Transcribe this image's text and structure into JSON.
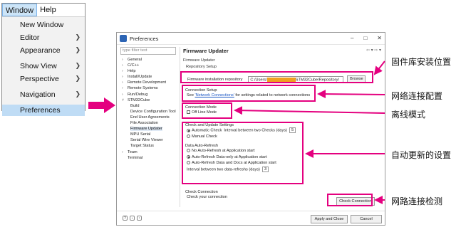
{
  "menu": {
    "bar": [
      "Window",
      "Help"
    ],
    "items": [
      {
        "label": "New Window",
        "submenu": false
      },
      {
        "label": "Editor",
        "submenu": true
      },
      {
        "label": "Appearance",
        "submenu": true
      },
      {
        "label": "Show View",
        "submenu": true
      },
      {
        "label": "Perspective",
        "submenu": true
      },
      {
        "label": "Navigation",
        "submenu": true
      },
      {
        "label": "Preferences",
        "submenu": false
      }
    ],
    "highlighted": "Preferences"
  },
  "dialog": {
    "title": "Preferences",
    "filter_placeholder": "type filter text",
    "tree": [
      {
        "label": "General",
        "level": 0,
        "expanded": false
      },
      {
        "label": "C/C++",
        "level": 0,
        "expanded": false
      },
      {
        "label": "Help",
        "level": 0,
        "expanded": false
      },
      {
        "label": "Install/Update",
        "level": 0,
        "expanded": false
      },
      {
        "label": "Remote Development",
        "level": 0,
        "expanded": false
      },
      {
        "label": "Remote Systems",
        "level": 0,
        "expanded": false
      },
      {
        "label": "Run/Debug",
        "level": 0,
        "expanded": false
      },
      {
        "label": "STM32Cube",
        "level": 0,
        "expanded": true
      },
      {
        "label": "Build",
        "level": 1
      },
      {
        "label": "Device Configuration Tool",
        "level": 1
      },
      {
        "label": "End User Agreements",
        "level": 1
      },
      {
        "label": "File Association",
        "level": 1
      },
      {
        "label": "Firmware Updater",
        "level": 1,
        "selected": true
      },
      {
        "label": "MPU Serial",
        "level": 1
      },
      {
        "label": "Serial Wire Viewer",
        "level": 1
      },
      {
        "label": "Target Status",
        "level": 1
      },
      {
        "label": "Team",
        "level": 0,
        "expanded": false
      },
      {
        "label": "Terminal",
        "level": 0
      }
    ],
    "page_title": "Firmware Updater",
    "subtitle": "Firmware Updater",
    "sub2": "Repository Setup",
    "repo": {
      "label": "Firmware installation repository",
      "value_prefix": "C:/Users/",
      "value_suffix": "STM32Cube/Repository/",
      "browse": "Browse"
    },
    "connection": {
      "title": "Connection Setup",
      "text_pre": "See ",
      "link": "'Network Connections'",
      "text_post": " for settings related to network connections"
    },
    "mode": {
      "title": "Connection Mode",
      "offline_label": "Off Line Mode",
      "offline_checked": false
    },
    "check_settings": {
      "title": "Check and Update Settings",
      "auto_label": "Automatic Check",
      "interval_label": "Interval between two Checks (days)",
      "interval_value": "5",
      "manual_label": "Manual Check",
      "selected": "auto"
    },
    "data_refresh": {
      "title": "Data Auto-Refresh",
      "options": [
        {
          "label": "No Auto-Refresh at Application start",
          "selected": false
        },
        {
          "label": "Auto-Refresh Data-only at Application start",
          "selected": true
        },
        {
          "label": "Auto-Refresh Data and Docs at Application start",
          "selected": false
        }
      ],
      "interval_label": "Interval between two data-refreshs (days)",
      "interval_value": "3"
    },
    "check_connection": {
      "title": "Check Connection",
      "text": "Check your connection",
      "button": "Check Connection"
    },
    "footer": {
      "apply": "Apply and Close",
      "cancel": "Cancel"
    }
  },
  "annotations": {
    "repo": "固件库安装位置",
    "network": "网络连接配置",
    "offline": "离线模式",
    "auto_update": "自动更新的设置",
    "check": "网路连接检测"
  },
  "colors": {
    "highlight": "#e4007f",
    "menu_highlight": "#bfdcf5",
    "link": "#1a56c4",
    "redaction": "#f0a020"
  }
}
